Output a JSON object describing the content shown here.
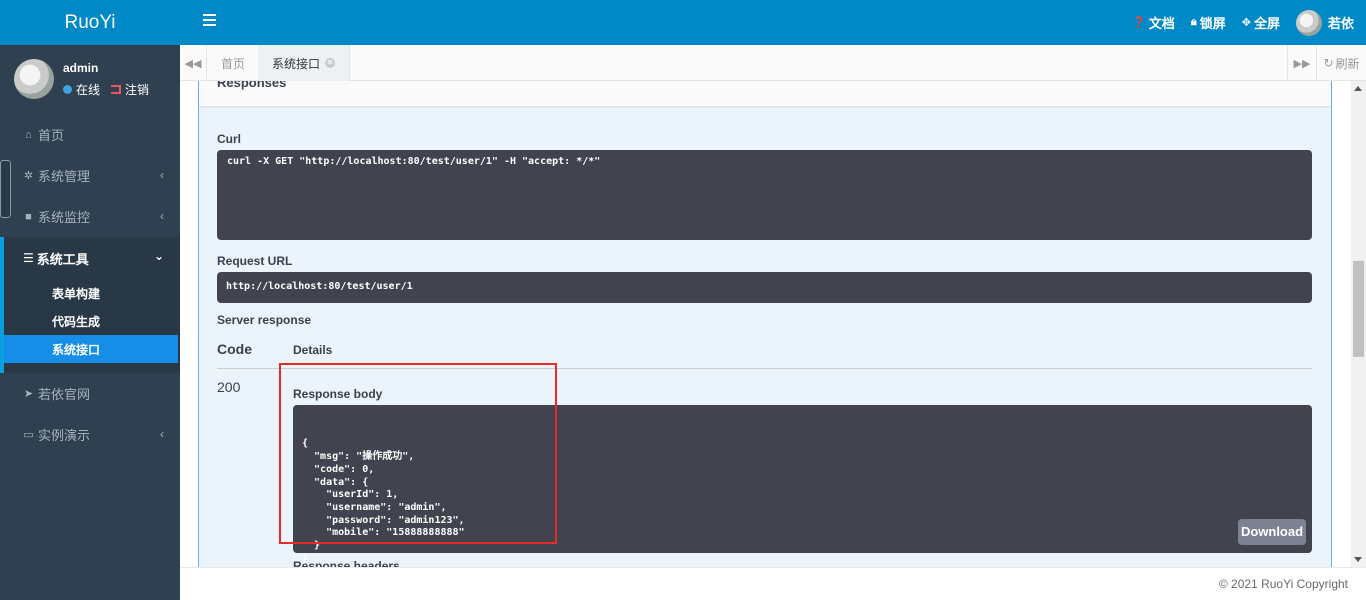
{
  "app": {
    "logo": "RuoYi"
  },
  "user_panel": {
    "name": "admin",
    "status": "在线",
    "logout": "注销"
  },
  "sidebar": {
    "items": [
      {
        "label": "首页",
        "icon": "home-icon"
      },
      {
        "label": "系统管理",
        "icon": "gear-icon",
        "arrow": "‹"
      },
      {
        "label": "系统监控",
        "icon": "video-icon",
        "arrow": "‹"
      },
      {
        "label": "系统工具",
        "icon": "bars-icon",
        "arrow": "⌄",
        "children": [
          {
            "label": "表单构建"
          },
          {
            "label": "代码生成"
          },
          {
            "label": "系统接口",
            "active": true
          }
        ]
      },
      {
        "label": "若依官网",
        "icon": "send-icon"
      },
      {
        "label": "实例演示",
        "icon": "desktop-icon",
        "arrow": "‹"
      }
    ]
  },
  "topbar": {
    "docs": "文档",
    "lock": "锁屏",
    "fullscreen": "全屏",
    "user": "若依"
  },
  "tabs": {
    "items": [
      {
        "label": "首页"
      },
      {
        "label": "系统接口",
        "active": true
      }
    ],
    "refresh": "刷新"
  },
  "swagger": {
    "section_title": "Responses",
    "curl_label": "Curl",
    "curl_command": "curl -X GET \"http://localhost:80/test/user/1\" -H \"accept: */*\"",
    "request_url_label": "Request URL",
    "request_url": "http://localhost:80/test/user/1",
    "server_response_label": "Server response",
    "col_code": "Code",
    "col_details": "Details",
    "status_code": "200",
    "response_body_label": "Response body",
    "response_body": "{\n  \"msg\": \"操作成功\",\n  \"code\": 0,\n  \"data\": {\n    \"userId\": 1,\n    \"username\": \"admin\",\n    \"password\": \"admin123\",\n    \"mobile\": \"15888888888\"\n  }\n}",
    "download_label": "Download",
    "next_label_partial": "Response headers"
  },
  "footer": {
    "copyright": "© 2021 RuoYi Copyright"
  },
  "colors": {
    "brand": "#0089c7",
    "sidebar_bg": "#2f4050",
    "active_item": "#168ee8",
    "code_bg": "#41444e",
    "highlight": "#e52c2c"
  }
}
